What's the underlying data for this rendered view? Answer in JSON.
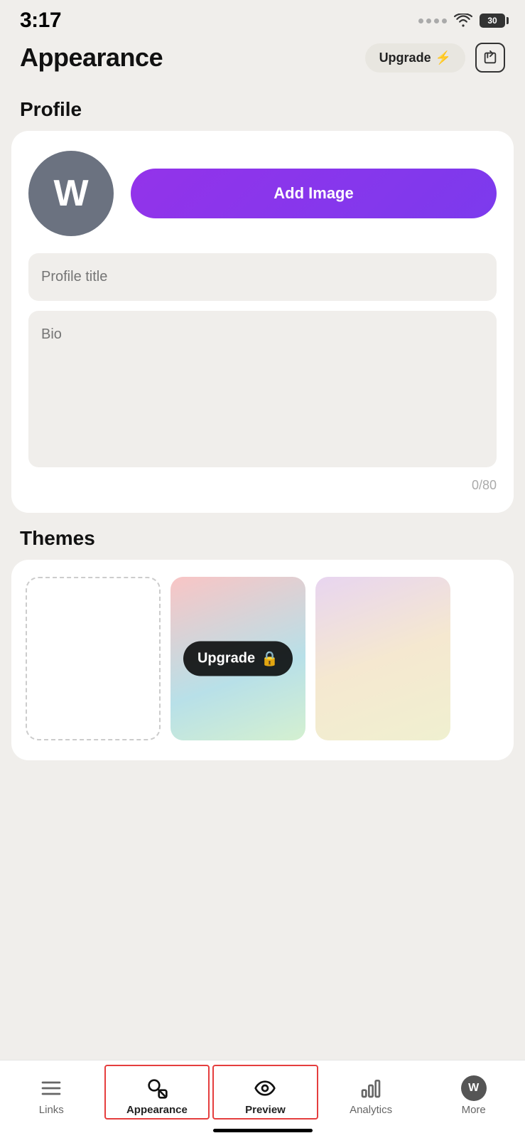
{
  "statusBar": {
    "time": "3:17",
    "battery": "30"
  },
  "header": {
    "title": "Appearance",
    "upgradeLabel": "Upgrade",
    "shareAriaLabel": "Share"
  },
  "profile": {
    "sectionTitle": "Profile",
    "avatarLetter": "W",
    "addImageLabel": "Add Image",
    "profileTitlePlaceholder": "Profile title",
    "bioPlaceholder": "Bio",
    "charCount": "0/80"
  },
  "themes": {
    "sectionTitle": "Themes",
    "upgradeOverlayLabel": "Upgrade"
  },
  "bottomNav": {
    "links": "Links",
    "appearance": "Appearance",
    "preview": "Preview",
    "analytics": "Analytics",
    "more": "More",
    "avatarLetter": "W"
  }
}
